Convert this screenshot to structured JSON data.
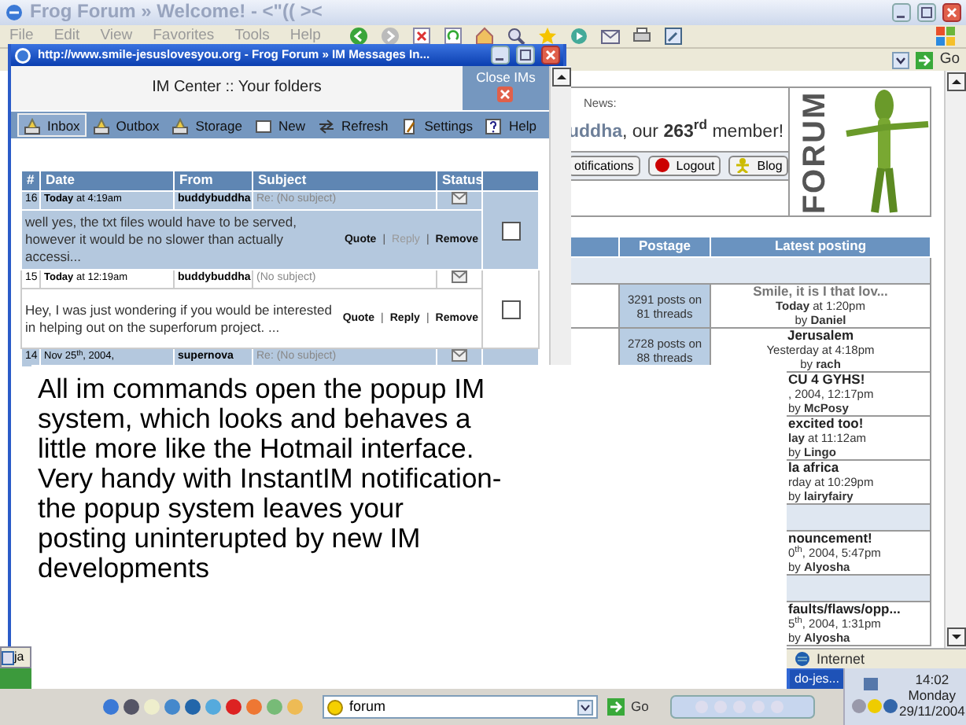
{
  "browser": {
    "title": "Frog Forum » Welcome! - <\"(( ><",
    "menu": [
      "File",
      "Edit",
      "View",
      "Favorites",
      "Tools",
      "Help"
    ],
    "go": "Go",
    "news": {
      "label": "News:",
      "message": "**uddha**, our **263$^{rd}$** member!"
    },
    "buttons": [
      "otifications",
      "Logout",
      "Blog"
    ],
    "logo": "FORUM",
    "forum_table": {
      "columns": [
        "Postage",
        "Latest posting"
      ],
      "rows": [
        {
          "kind": "band"
        },
        {
          "kind": "topic",
          "postage": "3291 posts on 81 threads",
          "title": "Smile, it is I that lov...",
          "when": "**Today** at 1:20pm",
          "by": "by **Daniel**"
        },
        {
          "kind": "topic",
          "postage": "2728 posts on 88 threads",
          "title": "Jerusalem",
          "when": "Yesterday at 4:18pm",
          "by": "by **rach**"
        },
        {
          "kind": "partial",
          "title": "CU 4 GYHS!",
          "when": ", 2004, 12:17pm",
          "by": "by **McPosy**"
        },
        {
          "kind": "partial",
          "title": "excited too!",
          "when": "**lay** at 11:12am",
          "by": "by **Lingo**"
        },
        {
          "kind": "partial",
          "title": "la africa",
          "when": "rday at 10:29pm",
          "by": "by **lairyfairy**"
        },
        {
          "kind": "band"
        },
        {
          "kind": "partial",
          "title": "nouncement!",
          "when": "0$^{th}$, 2004, 5:47pm",
          "by": "by **Alyosha**"
        },
        {
          "kind": "band"
        },
        {
          "kind": "partial",
          "title": "faults/flaws/opp...",
          "when": "5$^{th}$, 2004, 1:31pm",
          "by": "by **Alyosha**"
        }
      ]
    },
    "status": "Internet"
  },
  "popup": {
    "title": "http://www.smile-jesuslovesyou.org - Frog Forum » IM Messages In...",
    "heading": "IM Center :: Your folders",
    "close": "Close IMs",
    "toolbar": [
      {
        "label": "Inbox",
        "selected": true
      },
      {
        "label": "Outbox",
        "selected": false
      },
      {
        "label": "Storage",
        "selected": false
      },
      {
        "label": "New",
        "selected": false
      },
      {
        "label": "Refresh",
        "selected": false
      },
      {
        "label": "Settings",
        "selected": false
      },
      {
        "label": "Help",
        "selected": false
      }
    ],
    "columns": [
      "#",
      "Date",
      "From",
      "Subject",
      "Status"
    ],
    "messages": [
      {
        "number": "16",
        "date": "**Today** at 4:19am",
        "from": "buddybuddha",
        "subject": "Re: (No subject)",
        "body": "well yes, the txt files would have to be served, however it would be no slower than actually accessi...",
        "actions": [
          {
            "kind": "link",
            "label": "Quote",
            "disabled": false
          },
          {
            "kind": "separator",
            "label": "|",
            "disabled": false
          },
          {
            "kind": "link",
            "label": "Reply",
            "disabled": true
          },
          {
            "kind": "separator",
            "label": "|",
            "disabled": false
          },
          {
            "kind": "link",
            "label": "Remove",
            "disabled": false
          }
        ],
        "checked": false
      },
      {
        "number": "15",
        "date": "**Today** at 12:19am",
        "from": "buddybuddha",
        "subject": "(No subject)",
        "body": "Hey, I was just wondering if you would be interested in helping out on the superforum project.  ...",
        "actions": [
          {
            "kind": "link",
            "label": "Quote",
            "disabled": false
          },
          {
            "kind": "separator",
            "label": "|",
            "disabled": false
          },
          {
            "kind": "link",
            "label": "Reply",
            "disabled": false
          },
          {
            "kind": "separator",
            "label": "|",
            "disabled": false
          },
          {
            "kind": "link",
            "label": "Remove",
            "disabled": false
          }
        ],
        "checked": false
      },
      {
        "number": "14",
        "date": "Nov 25$^{th}$, 2004,",
        "from": "supernova",
        "subject": "Re: (No subject)"
      }
    ]
  },
  "caption": {
    "lines": [
      "All im commands open the popup IM",
      "system, which looks and behaves a",
      "little more like the Hotmail interface.",
      "Very handy with InstantIM notification-",
      "the popup system leaves your",
      "posting uninterupted by new IM",
      "developments"
    ]
  },
  "taskbar": {
    "items": [
      "ja",
      "do-jes..."
    ],
    "address": "forum",
    "go": "Go",
    "clock": {
      "time": "14:02",
      "day": "Monday",
      "date": "29/11/2004"
    }
  }
}
